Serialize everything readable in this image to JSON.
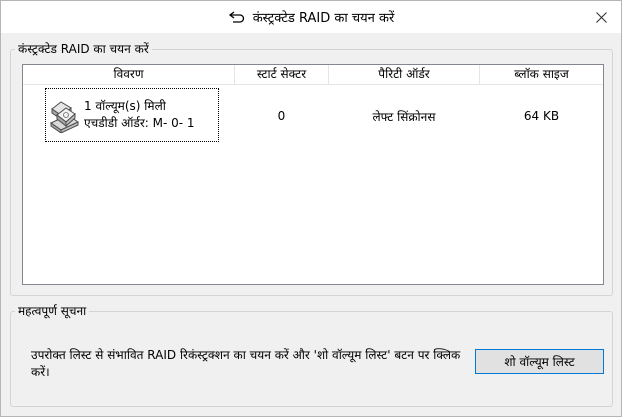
{
  "window": {
    "title": "कंस्ट्रक्टेड RAID का चयन करें",
    "icons": {
      "title": "back-arrow-icon",
      "close": "close-icon"
    }
  },
  "raid_group": {
    "legend": "कंस्ट्रक्टेड RAID का चयन करें",
    "columns": [
      "विवरण",
      "स्टार्ट सेक्टर",
      "पैरिटी ऑर्डर",
      "ब्लॉक साइज"
    ],
    "rows": [
      {
        "description_line1": "1 वॉल्यूम(s) मिली",
        "description_line2": "एचडीडी ऑर्डर: M- 0- 1",
        "start_sector": "0",
        "parity_order": "लेफ्ट सिंक्रोनस",
        "block_size": "64 KB",
        "icon": "hard-drives-icon"
      }
    ]
  },
  "notice_group": {
    "legend": "महत्वपूर्ण सूचना",
    "text": "उपरोक्त लिस्ट से संभावित RAID रिकंस्ट्रक्शन का चयन करें और 'शो वॉल्यूम लिस्ट' बटन पर क्लिक करें।",
    "button_label": "शो वॉल्यूम लिस्ट"
  },
  "colors": {
    "dialog_bg": "#f0f0f0",
    "button_focus_border": "#0078d7",
    "list_border": "#828790"
  }
}
